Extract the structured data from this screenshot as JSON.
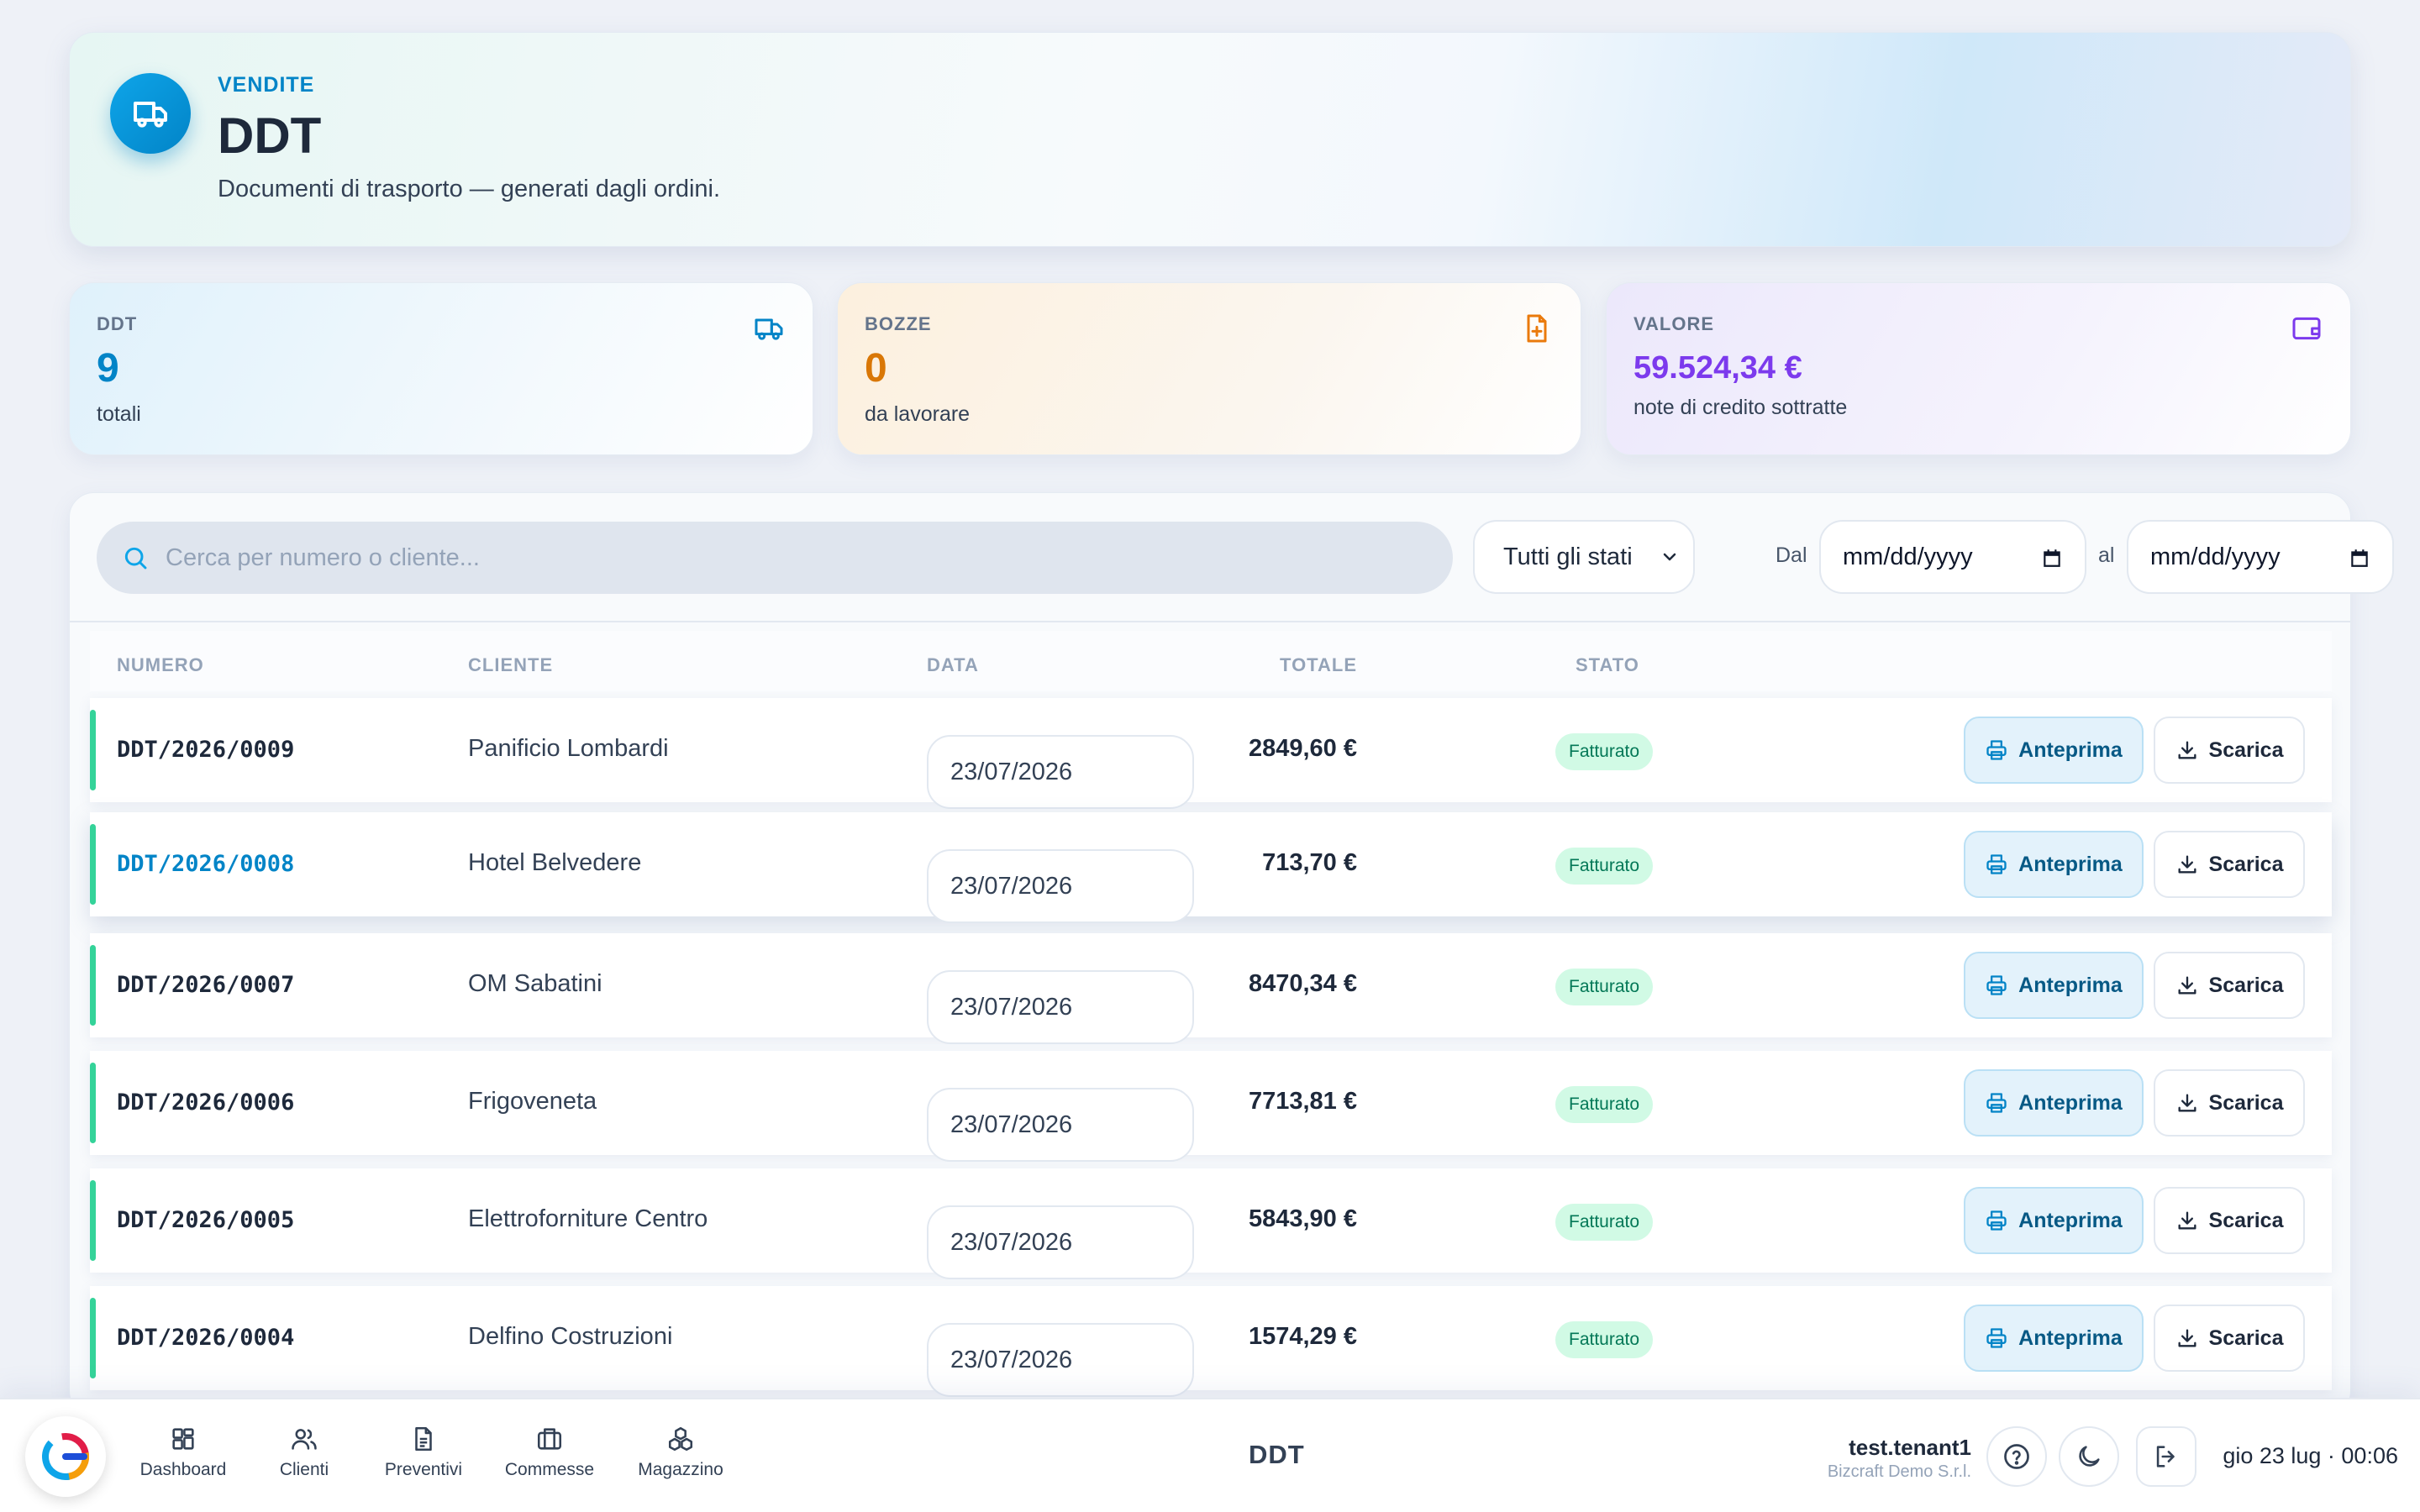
{
  "header": {
    "kicker": "VENDITE",
    "title": "DDT",
    "subtitle": "Documenti di trasporto — generati dagli ordini."
  },
  "stats": [
    {
      "label": "DDT",
      "value": "9",
      "note": "totali",
      "color": "#0284c7",
      "icon": "truck-icon"
    },
    {
      "label": "BOZZE",
      "value": "0",
      "note": "da lavorare",
      "color": "#d97706",
      "icon": "file-plus-icon"
    },
    {
      "label": "VALORE",
      "value": "59.524,34 €",
      "note": "note di credito sottratte",
      "color": "#7c3aed",
      "icon": "wallet-icon"
    }
  ],
  "filters": {
    "search_placeholder": "Cerca per numero o cliente...",
    "status_value": "Tutti gli stati",
    "from_label": "Dal",
    "to_label": "al",
    "date_placeholder": "mm/dd/yyyy"
  },
  "table": {
    "headers": {
      "number": "NUMERO",
      "client": "CLIENTE",
      "date": "DATA",
      "total": "TOTALE",
      "status": "STATO"
    },
    "rows": [
      {
        "number": "DDT/2026/0009",
        "client": "Panificio Lombardi",
        "date": "23/07/2026",
        "total": "2849,60 €",
        "status": "Fatturato"
      },
      {
        "number": "DDT/2026/0008",
        "client": "Hotel Belvedere",
        "date": "23/07/2026",
        "total": "713,70 €",
        "status": "Fatturato"
      },
      {
        "number": "DDT/2026/0007",
        "client": "OM Sabatini",
        "date": "23/07/2026",
        "total": "8470,34 €",
        "status": "Fatturato"
      },
      {
        "number": "DDT/2026/0006",
        "client": "Frigoveneta",
        "date": "23/07/2026",
        "total": "7713,81 €",
        "status": "Fatturato"
      },
      {
        "number": "DDT/2026/0005",
        "client": "Elettroforniture Centro",
        "date": "23/07/2026",
        "total": "5843,90 €",
        "status": "Fatturato"
      },
      {
        "number": "DDT/2026/0004",
        "client": "Delfino Costruzioni",
        "date": "23/07/2026",
        "total": "1574,29 €",
        "status": "Fatturato"
      }
    ],
    "preview_label": "Anteprima",
    "download_label": "Scarica"
  },
  "dock": {
    "nav": [
      {
        "label": "Dashboard",
        "icon": "dashboard-icon"
      },
      {
        "label": "Clienti",
        "icon": "users-icon"
      },
      {
        "label": "Preventivi",
        "icon": "document-icon"
      },
      {
        "label": "Commesse",
        "icon": "briefcase-icon"
      },
      {
        "label": "Magazzino",
        "icon": "boxes-icon"
      }
    ],
    "title": "DDT",
    "user_name": "test.tenant1",
    "user_org": "Bizcraft Demo S.r.l.",
    "clock": "gio 23 lug · 00:06"
  }
}
